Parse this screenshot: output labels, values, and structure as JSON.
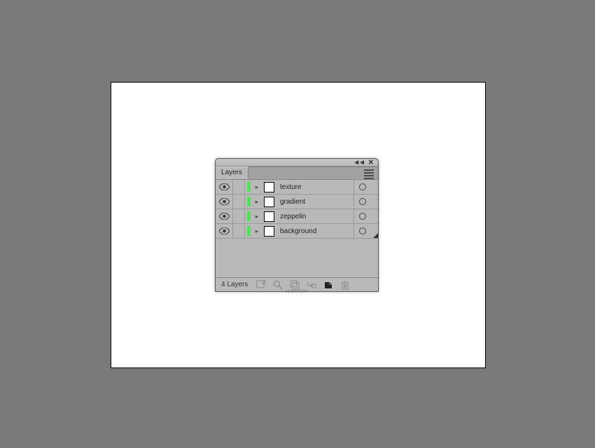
{
  "panel": {
    "title": "Layers",
    "footer_count": "4 Layers",
    "layers": [
      {
        "name": "texture"
      },
      {
        "name": "gradient"
      },
      {
        "name": "zeppelin"
      },
      {
        "name": "background"
      }
    ]
  }
}
